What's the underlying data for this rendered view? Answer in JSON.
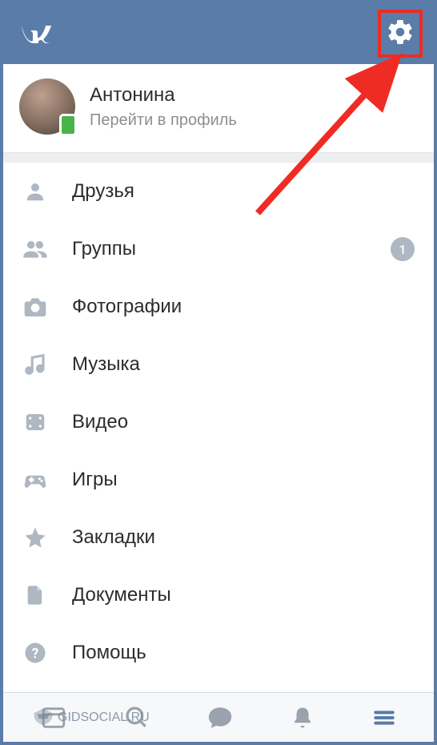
{
  "header": {
    "logo_text": "VK"
  },
  "profile": {
    "name": "Антонина",
    "subtitle": "Перейти в профиль"
  },
  "menu": {
    "items": [
      {
        "icon": "person",
        "label": "Друзья",
        "badge": null
      },
      {
        "icon": "people",
        "label": "Группы",
        "badge": "1"
      },
      {
        "icon": "camera",
        "label": "Фотографии",
        "badge": null
      },
      {
        "icon": "music",
        "label": "Музыка",
        "badge": null
      },
      {
        "icon": "video",
        "label": "Видео",
        "badge": null
      },
      {
        "icon": "gamepad",
        "label": "Игры",
        "badge": null
      },
      {
        "icon": "star",
        "label": "Закладки",
        "badge": null
      },
      {
        "icon": "document",
        "label": "Документы",
        "badge": null
      },
      {
        "icon": "help",
        "label": "Помощь",
        "badge": null
      }
    ]
  },
  "watermark": {
    "text": "GIDSOCIAL.RU"
  }
}
